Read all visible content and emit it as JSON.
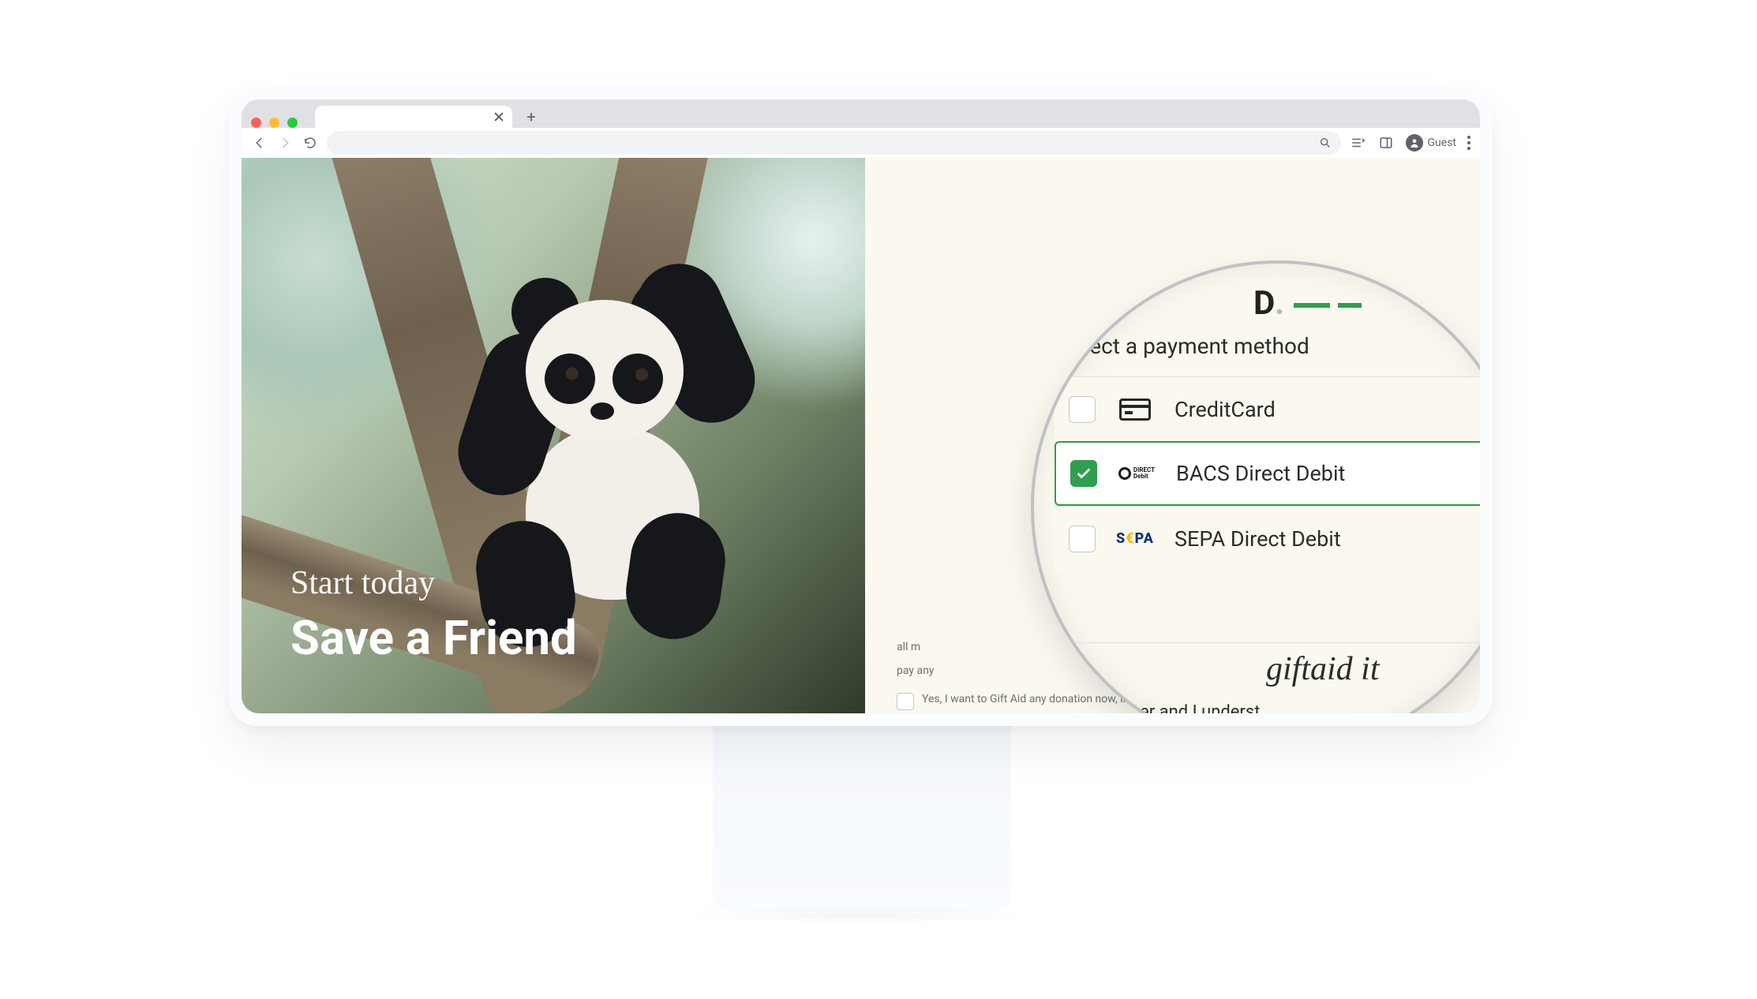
{
  "browser": {
    "guest_label": "Guest"
  },
  "hero": {
    "kicker": "Start today",
    "title": "Save a Friend"
  },
  "panel": {
    "section_title": "Select a payment method",
    "options": [
      {
        "label": "CreditCard",
        "selected": false,
        "logo": "credit-card"
      },
      {
        "label": "BACS Direct Debit",
        "selected": true,
        "logo": "direct-debit"
      },
      {
        "label": "SEPA Direct Debit",
        "selected": false,
        "logo": "sepa"
      }
    ],
    "giftaid_logo_text": "giftaid it",
    "background_lines": {
      "l1": "all m",
      "l2": "pay any"
    },
    "bottom_partial": "ayer and I underst",
    "giftaid_consent": "Yes, I want to Gift Aid any donation now, in the future and in the past four years"
  }
}
